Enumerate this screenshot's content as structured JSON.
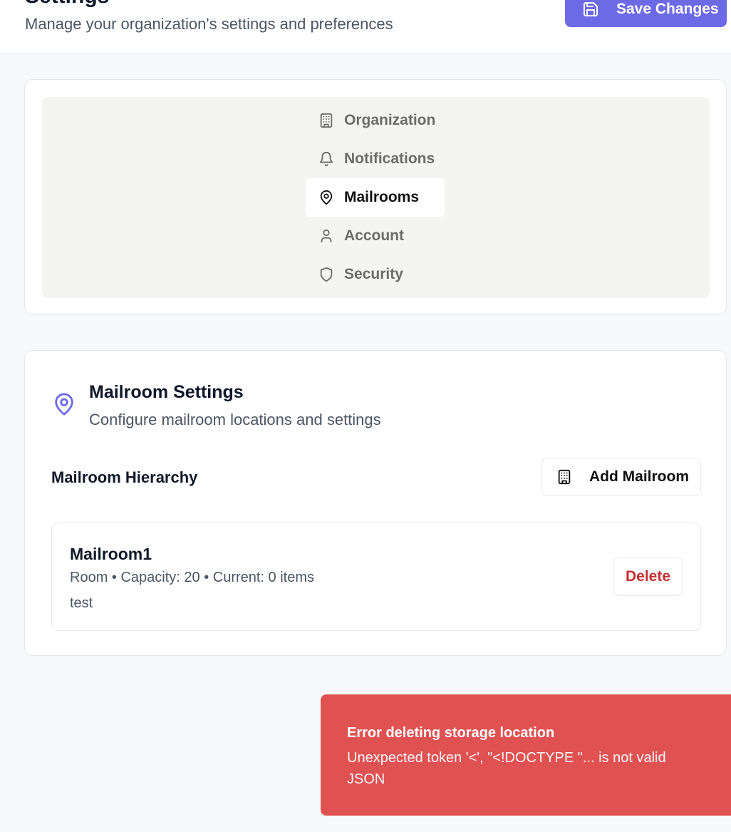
{
  "header": {
    "title": "Settings",
    "subtitle": "Manage your organization's settings and preferences",
    "save_label": "Save Changes"
  },
  "tabs": [
    {
      "label": "Organization",
      "icon": "building-icon",
      "active": false
    },
    {
      "label": "Notifications",
      "icon": "bell-icon",
      "active": false
    },
    {
      "label": "Mailrooms",
      "icon": "map-pin-icon",
      "active": true
    },
    {
      "label": "Account",
      "icon": "user-icon",
      "active": false
    },
    {
      "label": "Security",
      "icon": "shield-icon",
      "active": false
    }
  ],
  "mailroom_section": {
    "title": "Mailroom Settings",
    "subtitle": "Configure mailroom locations and settings",
    "hierarchy_label": "Mailroom Hierarchy",
    "add_label": "Add Mailroom",
    "items": [
      {
        "name": "Mailroom1",
        "meta": "Room • Capacity: 20 • Current: 0 items",
        "description": "test",
        "delete_label": "Delete"
      }
    ]
  },
  "toast": {
    "title": "Error deleting storage location",
    "message": "Unexpected token '<', \"<!DOCTYPE \"... is not valid JSON"
  },
  "colors": {
    "accent": "#6d6ae8",
    "danger": "#c53030",
    "toast_bg": "#e05252"
  }
}
